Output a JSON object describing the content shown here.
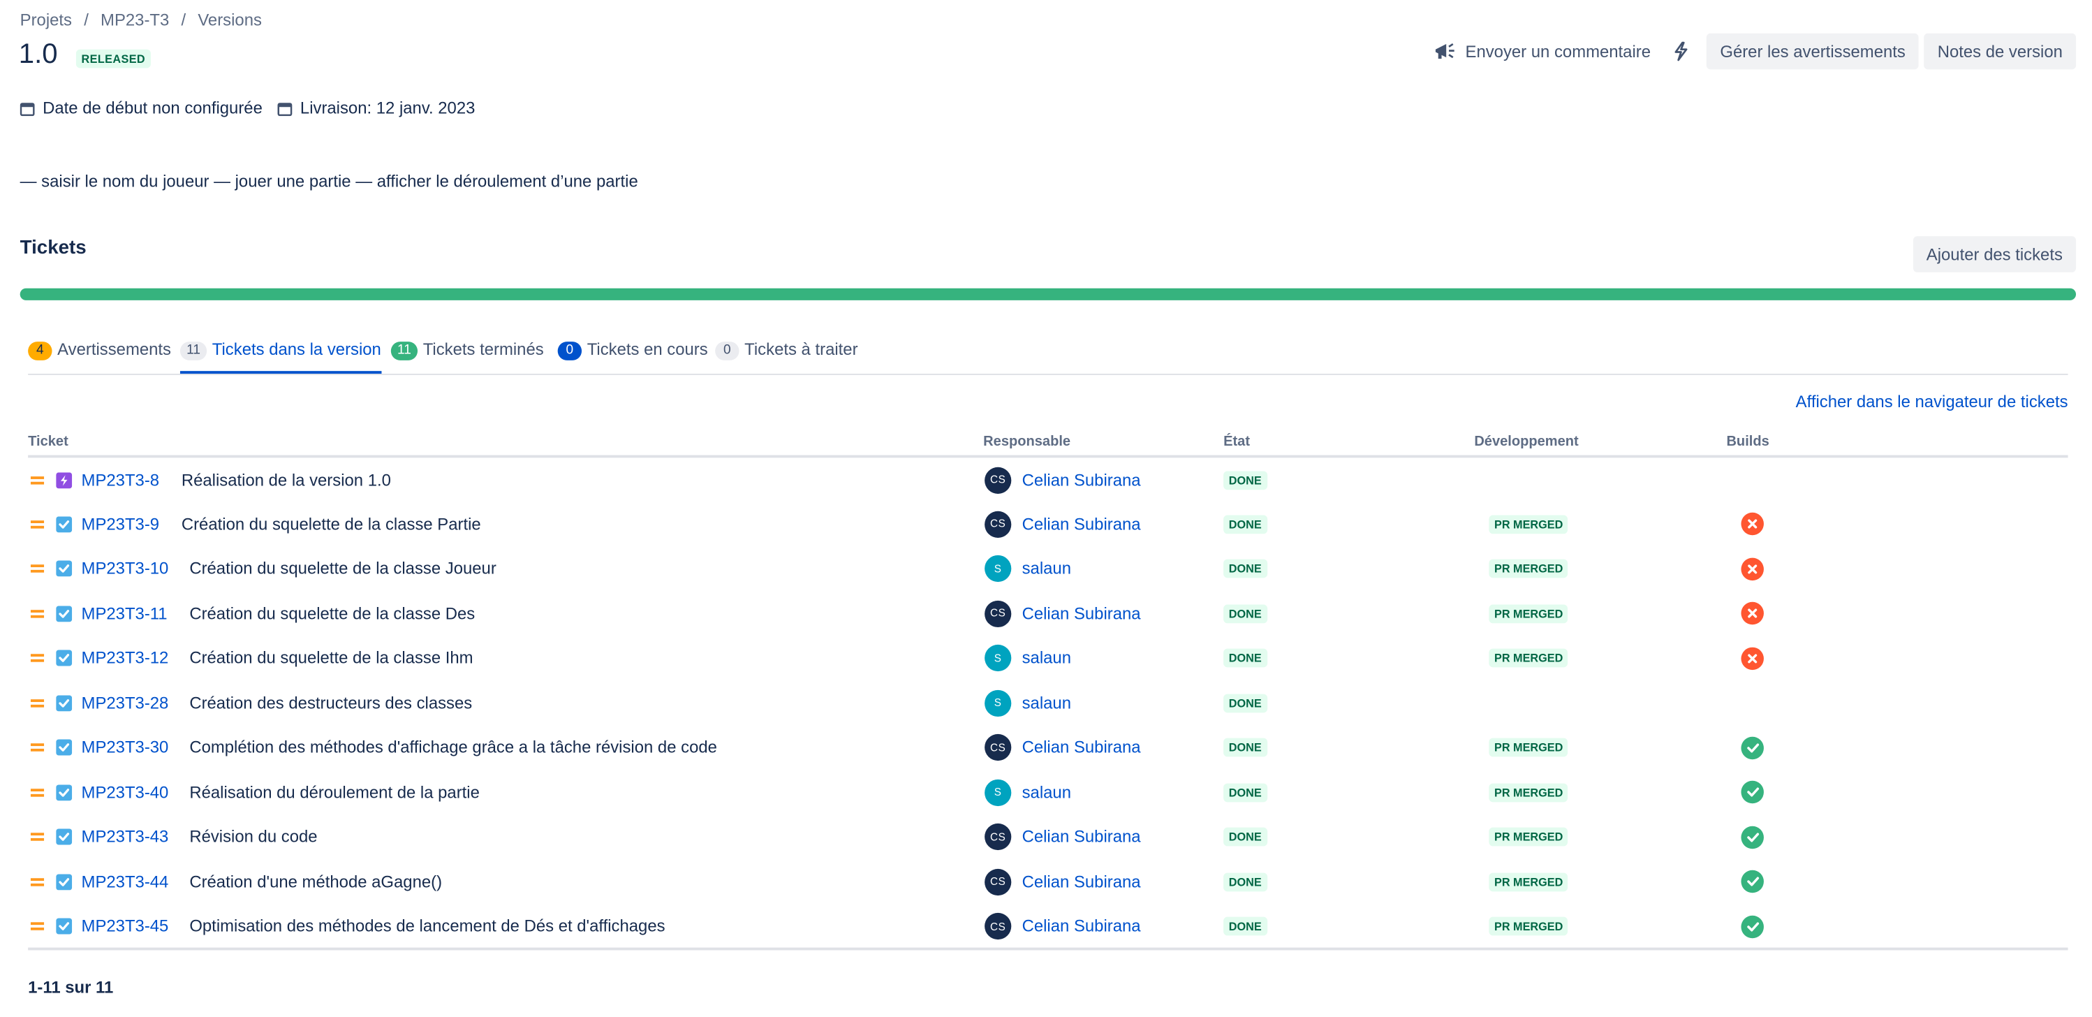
{
  "breadcrumb": [
    "Projets",
    "MP23-T3",
    "Versions"
  ],
  "breadcrumb_separator": "/",
  "version": {
    "name": "1.0",
    "status": "RELEASED"
  },
  "header_actions": {
    "feedback_label": "Envoyer un commentaire",
    "feedback_icon": "megaphone-icon",
    "bolt_icon": "lightning-icon",
    "manage_warnings_label": "Gérer les avertissements",
    "release_notes_label": "Notes de version"
  },
  "dates": {
    "start_label": "Date de début non configurée",
    "release_label": "Livraison: 12 janv. 2023",
    "icon": "calendar-icon"
  },
  "description": "— saisir le nom du joueur — jouer une partie — afficher le déroulement d’une partie",
  "tickets_section": {
    "title": "Tickets",
    "add_button_label": "Ajouter des tickets",
    "progress_done_fraction": 1.0
  },
  "tabs": [
    {
      "count": "4",
      "label": "Avertissements"
    },
    {
      "count": "11",
      "label": "Tickets dans la version"
    },
    {
      "count": "11",
      "label": "Tickets terminés"
    },
    {
      "count": "0",
      "label": "Tickets en cours"
    },
    {
      "count": "0",
      "label": "Tickets à traiter"
    }
  ],
  "navigator_link": "Afficher dans le navigateur de tickets",
  "table": {
    "headers": {
      "ticket": "Ticket",
      "assignee": "Responsable",
      "status": "État",
      "development": "Développement",
      "builds": "Builds"
    },
    "rows": [
      {
        "priority_icon": "priority-medium-icon",
        "type_icon": "epic-icon",
        "key": "MP23T3-8",
        "summary": "Réalisation de la version 1.0",
        "initials": "CS",
        "assignee": "Celian Subirana",
        "status": "DONE",
        "development": "",
        "build": ""
      },
      {
        "priority_icon": "priority-medium-icon",
        "type_icon": "task-icon",
        "key": "MP23T3-9",
        "summary": "Création du squelette de la classe Partie",
        "initials": "CS",
        "assignee": "Celian Subirana",
        "status": "DONE",
        "development": "PR MERGED",
        "build": "failed"
      },
      {
        "priority_icon": "priority-medium-icon",
        "type_icon": "task-icon",
        "key": "MP23T3-10",
        "summary": "Création du squelette de la classe Joueur",
        "initials": "S",
        "assignee": "salaun",
        "status": "DONE",
        "development": "PR MERGED",
        "build": "failed"
      },
      {
        "priority_icon": "priority-medium-icon",
        "type_icon": "task-icon",
        "key": "MP23T3-11",
        "summary": "Création du squelette de la classe Des",
        "initials": "CS",
        "assignee": "Celian Subirana",
        "status": "DONE",
        "development": "PR MERGED",
        "build": "failed"
      },
      {
        "priority_icon": "priority-medium-icon",
        "type_icon": "task-icon",
        "key": "MP23T3-12",
        "summary": "Création du squelette de la classe Ihm",
        "initials": "S",
        "assignee": "salaun",
        "status": "DONE",
        "development": "PR MERGED",
        "build": "failed"
      },
      {
        "priority_icon": "priority-medium-icon",
        "type_icon": "task-icon",
        "key": "MP23T3-28",
        "summary": "Création des destructeurs des classes",
        "initials": "S",
        "assignee": "salaun",
        "status": "DONE",
        "development": "",
        "build": ""
      },
      {
        "priority_icon": "priority-medium-icon",
        "type_icon": "task-icon",
        "key": "MP23T3-30",
        "summary": "Complétion des méthodes d'affichage grâce a la tâche révision de code",
        "initials": "CS",
        "assignee": "Celian Subirana",
        "status": "DONE",
        "development": "PR MERGED",
        "build": "success"
      },
      {
        "priority_icon": "priority-medium-icon",
        "type_icon": "task-icon",
        "key": "MP23T3-40",
        "summary": "Réalisation du déroulement de la partie",
        "initials": "S",
        "assignee": "salaun",
        "status": "DONE",
        "development": "PR MERGED",
        "build": "success"
      },
      {
        "priority_icon": "priority-medium-icon",
        "type_icon": "task-icon",
        "key": "MP23T3-43",
        "summary": "Révision du code",
        "initials": "CS",
        "assignee": "Celian Subirana",
        "status": "DONE",
        "development": "PR MERGED",
        "build": "success"
      },
      {
        "priority_icon": "priority-medium-icon",
        "type_icon": "task-icon",
        "key": "MP23T3-44",
        "summary": "Création d'une méthode aGagne()",
        "initials": "CS",
        "assignee": "Celian Subirana",
        "status": "DONE",
        "development": "PR MERGED",
        "build": "success"
      },
      {
        "priority_icon": "priority-medium-icon",
        "type_icon": "task-icon",
        "key": "MP23T3-45",
        "summary": "Optimisation des méthodes de lancement de Dés et d'affichages",
        "initials": "CS",
        "assignee": "Celian Subirana",
        "status": "DONE",
        "development": "PR MERGED",
        "build": "success"
      }
    ]
  },
  "pagination": "1-11 sur 11",
  "colors": {
    "link": "#0052cc",
    "progress_done": "#36b37e",
    "done_lozenge_bg": "#e3fcef",
    "done_lozenge_text": "#006644",
    "build_failed": "#ff5630",
    "build_success": "#36b37e",
    "priority_medium": "#ff991f",
    "task_icon": "#4bade8",
    "epic_icon": "#904ee2",
    "avatar_cs": "#172b4d",
    "avatar_s": "#00a3bf",
    "warning_count": "#ffab00"
  }
}
